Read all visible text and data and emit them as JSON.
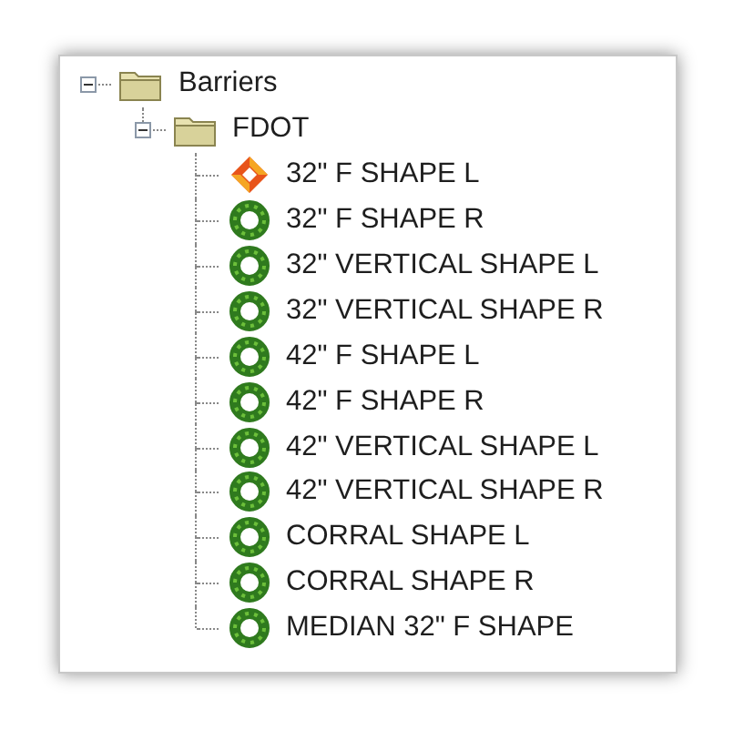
{
  "tree": [
    {
      "label": "Barriers",
      "kind": "folder",
      "expanded": true,
      "children": [
        {
          "label": "FDOT",
          "kind": "folder",
          "expanded": true,
          "children": [
            {
              "label": "32\" F SHAPE L",
              "kind": "diamond"
            },
            {
              "label": "32\" F SHAPE R",
              "kind": "ring"
            },
            {
              "label": "32\" VERTICAL SHAPE L",
              "kind": "ring"
            },
            {
              "label": "32\" VERTICAL SHAPE R",
              "kind": "ring"
            },
            {
              "label": "42\" F SHAPE L",
              "kind": "ring"
            },
            {
              "label": "42\" F SHAPE R",
              "kind": "ring"
            },
            {
              "label": "42\" VERTICAL SHAPE L",
              "kind": "ring"
            },
            {
              "label": "42\" VERTICAL SHAPE R",
              "kind": "ring"
            },
            {
              "label": "CORRAL SHAPE L",
              "kind": "ring"
            },
            {
              "label": "CORRAL SHAPE R",
              "kind": "ring"
            },
            {
              "label": "MEDIAN 32\" F SHAPE",
              "kind": "ring"
            }
          ]
        }
      ]
    }
  ]
}
